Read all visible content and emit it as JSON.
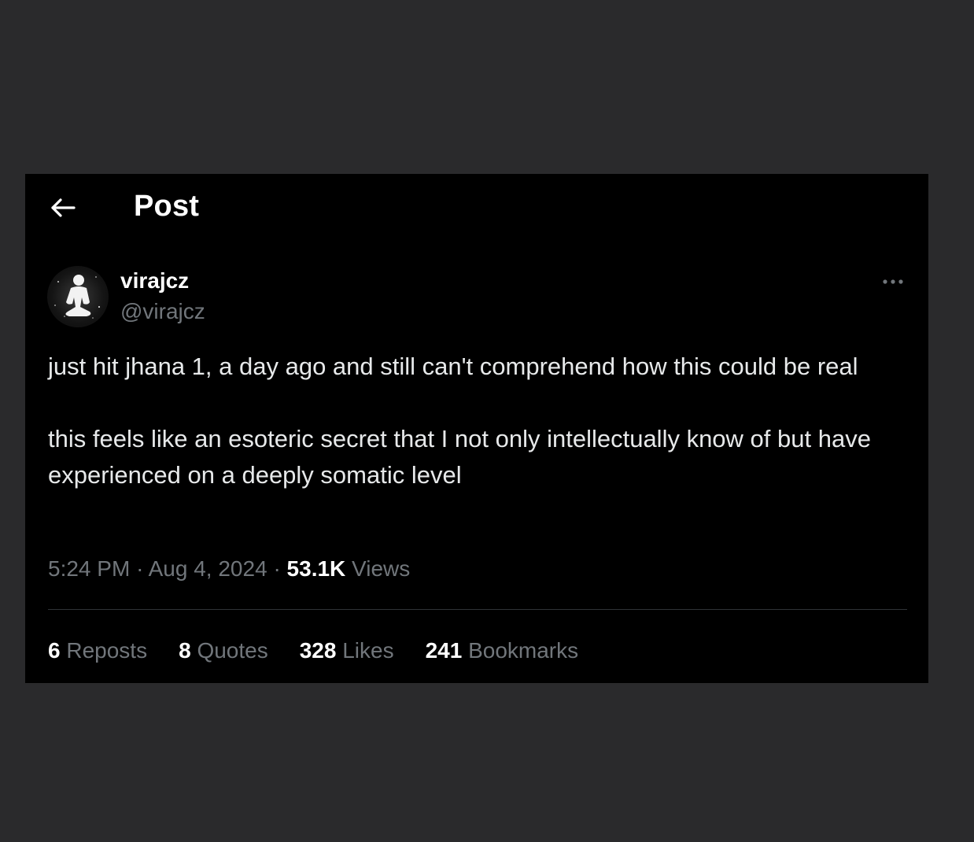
{
  "header": {
    "title": "Post",
    "back_icon": "arrow-left-icon"
  },
  "author": {
    "display_name": "virajcz",
    "handle": "@virajcz",
    "avatar_icon": "meditating-figure-avatar"
  },
  "more_icon": "more-horizontal-icon",
  "tweet": {
    "text": "just hit jhana 1, a day ago and still can't comprehend how this could be real\n\nthis feels like an esoteric secret that I not only intellectually know of but have experienced on a deeply somatic level"
  },
  "meta": {
    "time": "5:24 PM",
    "separator": "·",
    "date": "Aug 4, 2024",
    "views_count": "53.1K",
    "views_label": "Views"
  },
  "stats": [
    {
      "count": "6",
      "label": "Reposts"
    },
    {
      "count": "8",
      "label": "Quotes"
    },
    {
      "count": "328",
      "label": "Likes"
    },
    {
      "count": "241",
      "label": "Bookmarks"
    }
  ],
  "colors": {
    "background": "#2a2a2c",
    "panel": "#000000",
    "primary_text": "#e7e9ea",
    "secondary_text": "#71767b",
    "divider": "#2f3336"
  }
}
